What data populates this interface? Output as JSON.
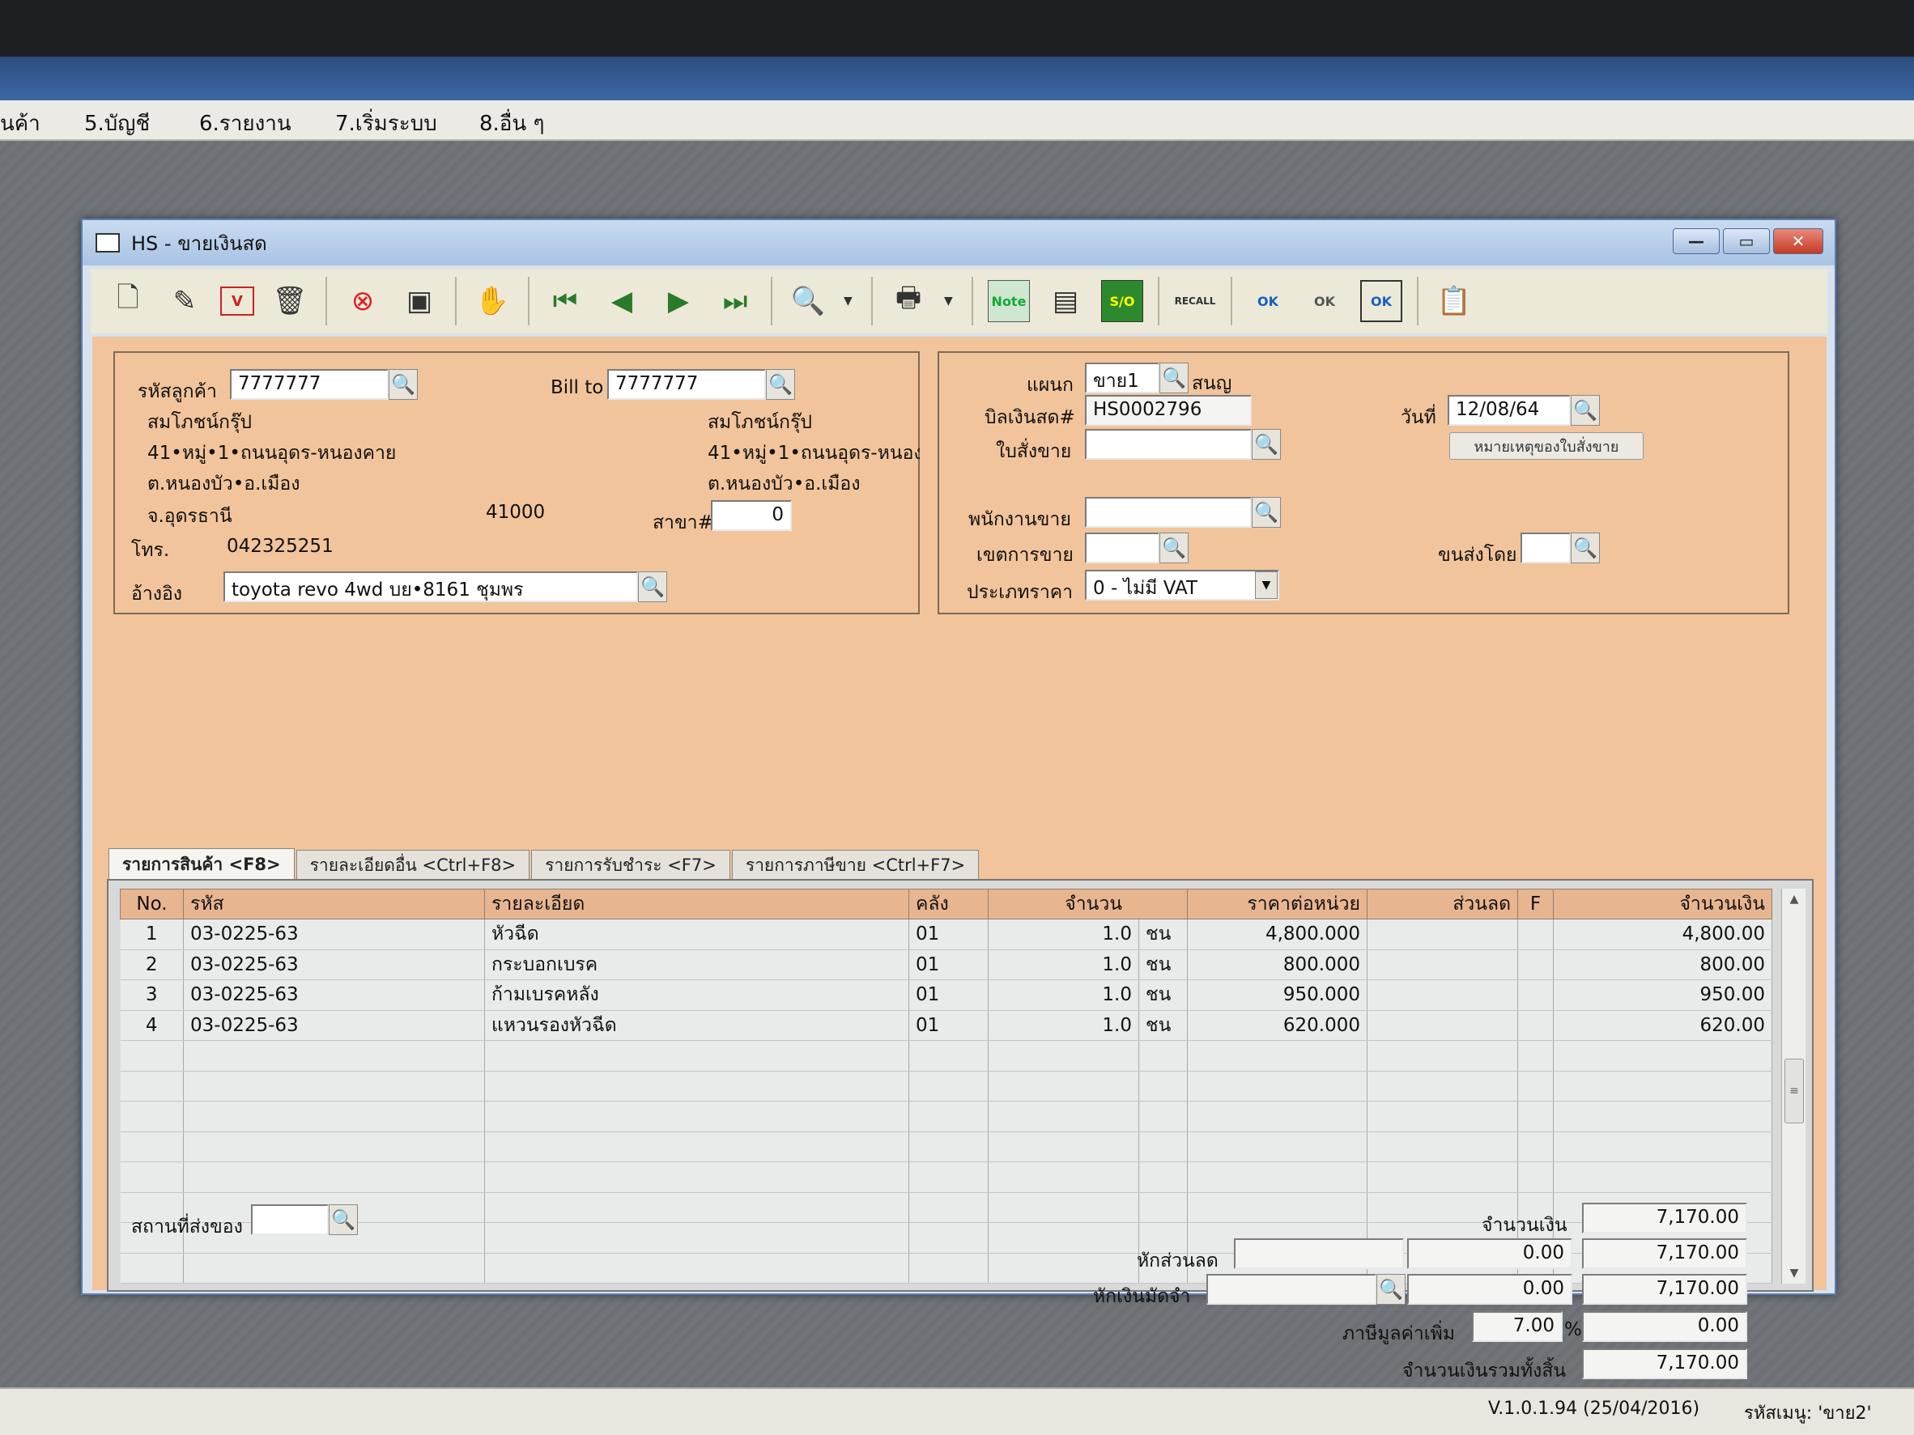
{
  "menubar": {
    "items": [
      "นค้า",
      "5.บัญชี",
      "6.รายงาน",
      "7.เริ่มระบบ",
      "8.อื่น ๆ"
    ]
  },
  "window": {
    "title": "HS - ขายเงินสด",
    "controls": {
      "minimize": "—",
      "maximize": "▭",
      "close": "✕"
    }
  },
  "toolbar": {
    "icons": [
      "new-document-icon",
      "edit-icon",
      "void-icon",
      "delete-icon",
      "cancel-icon",
      "save-icon",
      "handshake-icon",
      "first-record-icon",
      "previous-record-icon",
      "next-record-icon",
      "last-record-icon",
      "search-document-icon",
      "printer-icon",
      "note-icon",
      "form-icon",
      "so-icon",
      "recall-icon",
      "approve-ok-icon",
      "confirm-ok-icon",
      "checked-ok-icon",
      "report-icon"
    ],
    "note_label": "Note",
    "so_label": "S/O",
    "recall_label": "RECALL",
    "ok_label": "OK"
  },
  "customer": {
    "code_label": "รหัสลูกค้า",
    "code_value": "7777777",
    "bill_to_label": "Bill to",
    "bill_to_value": "7777777",
    "name": "สมโภชน์กรุ๊ป",
    "address1": "41•หมู่•1•ถนนอุดร-หนองคาย",
    "address2": "ต.หนองบัว•อ.เมือง",
    "province": "จ.อุดรธานี",
    "postcode": "41000",
    "bill_name": "สมโภชน์กรุ๊ป",
    "bill_address1": "41•หมู่•1•ถนนอุดร-หนอง",
    "bill_address2": "ต.หนองบัว•อ.เมือง",
    "branch_label": "สาขา#",
    "branch_value": "0",
    "phone_label": "โทร.",
    "phone_value": "042325251",
    "reference_label": "อ้างอิง",
    "reference_value": "toyota revo 4wd บย•8161 ชุมพร"
  },
  "document": {
    "department_label": "แผนก",
    "department_value": "ขาย1",
    "department_name": "สนญ",
    "bill_label": "บิลเงินสด#",
    "bill_value": "HS0002796",
    "date_label": "วันที่",
    "date_value": "12/08/64",
    "order_label": "ใบสั่งขาย",
    "order_value": "",
    "order_note_button": "หมายเหตุของใบสั่งขาย",
    "salesperson_label": "พนักงานขาย",
    "salesperson_value": "",
    "sales_area_label": "เขตการขาย",
    "sales_area_value": "",
    "ship_by_label": "ขนส่งโดย",
    "ship_by_value": "",
    "price_type_label": "ประเภทราคา",
    "price_type_value": "0 - ไม่มี VAT"
  },
  "tabs": [
    {
      "label": "รายการสินค้า <F8>",
      "active": true
    },
    {
      "label": "รายละเอียดอื่น <Ctrl+F8>",
      "active": false
    },
    {
      "label": "รายการรับชำระ <F7>",
      "active": false
    },
    {
      "label": "รายการภาษีขาย <Ctrl+F7>",
      "active": false
    }
  ],
  "grid": {
    "columns": [
      "No.",
      "รหัส",
      "รายละเอียด",
      "คลัง",
      "จำนวน",
      "ราคาต่อหน่วย",
      "ส่วนลด",
      "F",
      "จำนวนเงิน"
    ],
    "rows": [
      {
        "no": "1",
        "code": "03-0225-63",
        "desc": "หัวฉีด",
        "wh": "01",
        "qty": "1.0",
        "unit": "ชน",
        "price": "4,800.000",
        "discount": "",
        "f": "",
        "amount": "4,800.00"
      },
      {
        "no": "2",
        "code": "03-0225-63",
        "desc": "กระบอกเบรค",
        "wh": "01",
        "qty": "1.0",
        "unit": "ชน",
        "price": "800.000",
        "discount": "",
        "f": "",
        "amount": "800.00"
      },
      {
        "no": "3",
        "code": "03-0225-63",
        "desc": "ก้ามเบรคหลัง",
        "wh": "01",
        "qty": "1.0",
        "unit": "ชน",
        "price": "950.000",
        "discount": "",
        "f": "",
        "amount": "950.00"
      },
      {
        "no": "4",
        "code": "03-0225-63",
        "desc": "แหวนรองหัวฉีด",
        "wh": "01",
        "qty": "1.0",
        "unit": "ชน",
        "price": "620.000",
        "discount": "",
        "f": "",
        "amount": "620.00"
      }
    ],
    "empty_rows": 8
  },
  "footer": {
    "ship_place_label": "สถานที่ส่งของ",
    "ship_place_value": "",
    "amount_label": "จำนวนเงิน",
    "amount_value": "7,170.00",
    "discount_label": "หักส่วนลด",
    "discount_text": "",
    "discount_value": "0.00",
    "after_discount": "7,170.00",
    "deposit_label": "หักเงินมัดจำ",
    "deposit_text": "",
    "deposit_value": "0.00",
    "after_deposit": "7,170.00",
    "vat_label": "ภาษีมูลค่าเพิ่ม",
    "vat_rate": "7.00",
    "vat_percent": "%",
    "vat_value": "0.00",
    "total_label": "จำนวนเงินรวมทั้งสิ้น",
    "total_value": "7,170.00"
  },
  "status": {
    "version": "V.1.0.1.94 (25/04/2016)",
    "menu_code": "รหัสเมนู: 'ขาย2'"
  }
}
